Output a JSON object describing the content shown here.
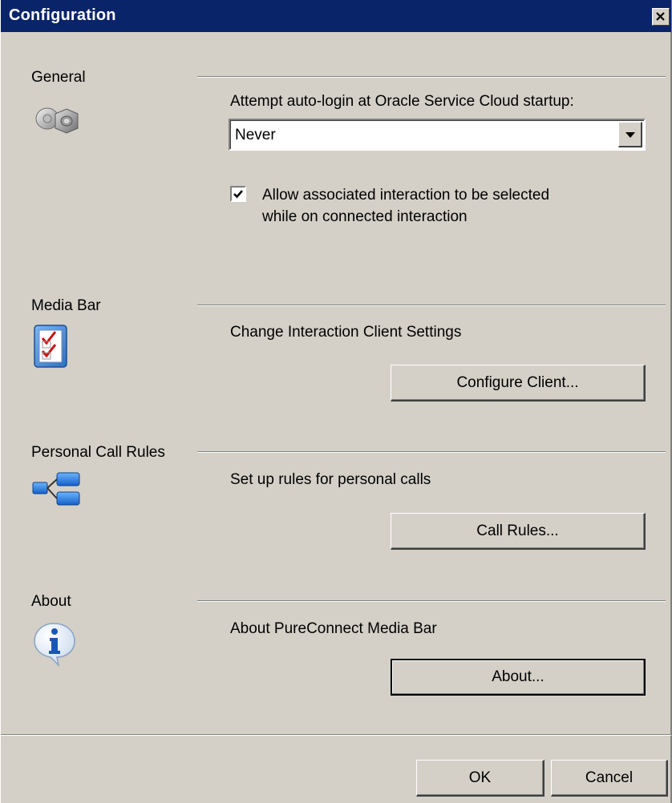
{
  "window": {
    "title": "Configuration"
  },
  "sections": {
    "general": {
      "label": "General",
      "icon": "gears-icon",
      "autologin_label": "Attempt auto-login at Oracle Service Cloud startup:",
      "autologin_value": "Never",
      "checkbox_checked": true,
      "checkbox_label_line1": "Allow associated interaction to be selected",
      "checkbox_label_line2": "while on connected interaction"
    },
    "media_bar": {
      "label": "Media Bar",
      "icon": "checklist-icon",
      "description": "Change Interaction Client Settings",
      "button_label": "Configure Client..."
    },
    "personal_call_rules": {
      "label": "Personal Call Rules",
      "icon": "rules-tree-icon",
      "description": "Set up rules for personal calls",
      "button_label": "Call Rules..."
    },
    "about": {
      "label": "About",
      "icon": "info-icon",
      "description": "About PureConnect Media Bar",
      "button_label": "About..."
    }
  },
  "footer": {
    "ok_label": "OK",
    "cancel_label": "Cancel"
  }
}
